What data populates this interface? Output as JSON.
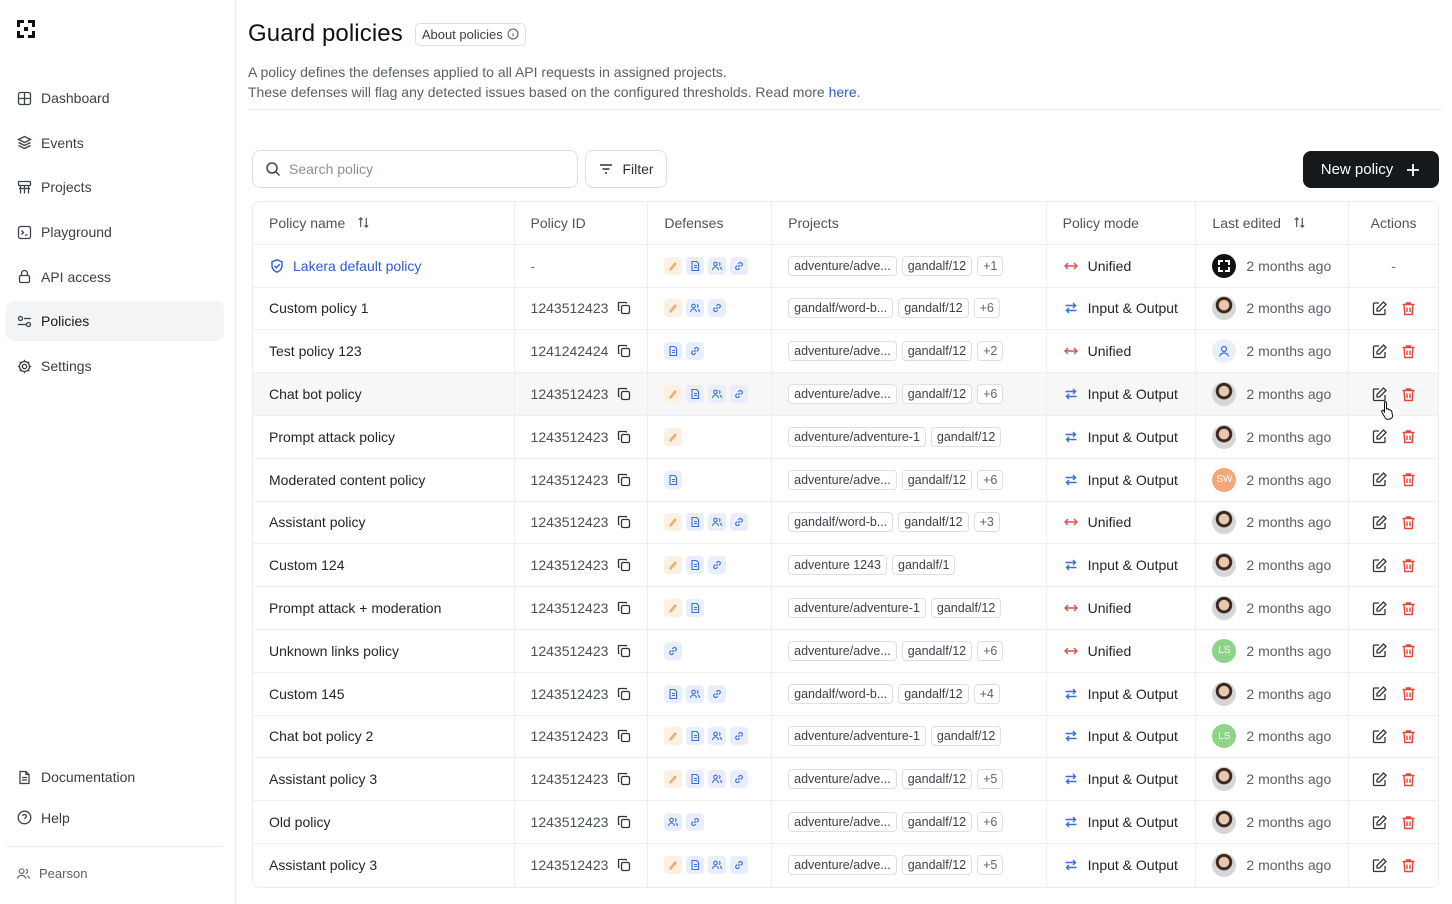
{
  "sidebar": {
    "logo": "lakera-logo",
    "items": [
      {
        "label": "Dashboard",
        "icon": "grid-icon"
      },
      {
        "label": "Events",
        "icon": "layers-icon"
      },
      {
        "label": "Projects",
        "icon": "sitemap-icon"
      },
      {
        "label": "Playground",
        "icon": "terminal-icon"
      },
      {
        "label": "API access",
        "icon": "lock-icon"
      },
      {
        "label": "Policies",
        "icon": "sliders-icon",
        "active": true
      },
      {
        "label": "Settings",
        "icon": "gear-icon"
      }
    ],
    "bottom_items": [
      {
        "label": "Documentation",
        "icon": "document-icon"
      },
      {
        "label": "Help",
        "icon": "help-icon"
      }
    ],
    "user": "Pearson"
  },
  "header": {
    "title": "Guard policies",
    "about_label": "About policies",
    "description_line1": "A policy defines the defenses applied to all API requests in assigned projects.",
    "description_line2": "These defenses will flag any detected issues based on the configured thresholds. Read more ",
    "description_link": "here",
    "description_end": "."
  },
  "toolbar": {
    "search_placeholder": "Search policy",
    "filter_label": "Filter",
    "new_policy_label": "New policy"
  },
  "table": {
    "columns": [
      "Policy name",
      "Policy ID",
      "Defenses",
      "Projects",
      "Policy mode",
      "Last edited",
      "Actions"
    ],
    "rows": [
      {
        "name": "Lakera default policy",
        "id": "-",
        "defenses": [
          "prompt",
          "content",
          "pii",
          "link"
        ],
        "projects": [
          "adventure/adve...",
          "gandalf/12"
        ],
        "more": "+1",
        "mode": "Unified",
        "avatar": "lakera",
        "edited": "2 months ago",
        "default": true
      },
      {
        "name": "Custom policy 1",
        "id": "1243512423",
        "defenses": [
          "prompt",
          "pii",
          "link"
        ],
        "projects": [
          "gandalf/word-b...",
          "gandalf/12"
        ],
        "more": "+6",
        "mode": "Input & Output",
        "avatar": "photo",
        "edited": "2 months ago"
      },
      {
        "name": "Test policy 123",
        "id": "1241242424",
        "defenses": [
          "content",
          "link"
        ],
        "projects": [
          "adventure/adve...",
          "gandalf/12"
        ],
        "more": "+2",
        "mode": "Unified",
        "avatar": "user",
        "edited": "2 months ago"
      },
      {
        "name": "Chat bot policy",
        "id": "1243512423",
        "defenses": [
          "prompt",
          "content",
          "pii",
          "link"
        ],
        "projects": [
          "adventure/adve...",
          "gandalf/12"
        ],
        "more": "+6",
        "mode": "Input & Output",
        "avatar": "photo",
        "edited": "2 months ago",
        "hover": true
      },
      {
        "name": "Prompt attack policy",
        "id": "1243512423",
        "defenses": [
          "prompt"
        ],
        "projects": [
          "adventure/adventure-1",
          "gandalf/12"
        ],
        "more": "",
        "mode": "Input & Output",
        "avatar": "photo",
        "edited": "2 months ago"
      },
      {
        "name": "Moderated content policy",
        "id": "1243512423",
        "defenses": [
          "content"
        ],
        "projects": [
          "adventure/adve...",
          "gandalf/12"
        ],
        "more": "+6",
        "mode": "Input & Output",
        "avatar": "SW",
        "edited": "2 months ago"
      },
      {
        "name": "Assistant policy",
        "id": "1243512423",
        "defenses": [
          "prompt",
          "content",
          "pii",
          "link"
        ],
        "projects": [
          "gandalf/word-b...",
          "gandalf/12"
        ],
        "more": "+3",
        "mode": "Unified",
        "avatar": "photo",
        "edited": "2 months ago"
      },
      {
        "name": "Custom 124",
        "id": "1243512423",
        "defenses": [
          "prompt",
          "content",
          "link"
        ],
        "projects": [
          "adventure 1243",
          "gandalf/1"
        ],
        "more": "",
        "mode": "Input & Output",
        "avatar": "photo",
        "edited": "2 months ago"
      },
      {
        "name": "Prompt attack + moderation",
        "id": "1243512423",
        "defenses": [
          "prompt",
          "content"
        ],
        "projects": [
          "adventure/adventure-1",
          "gandalf/12"
        ],
        "more": "",
        "mode": "Unified",
        "avatar": "photo",
        "edited": "2 months ago"
      },
      {
        "name": "Unknown links policy",
        "id": "1243512423",
        "defenses": [
          "link"
        ],
        "projects": [
          "adventure/adve...",
          "gandalf/12"
        ],
        "more": "+6",
        "mode": "Unified",
        "avatar": "LS",
        "edited": "2 months ago"
      },
      {
        "name": "Custom 145",
        "id": "1243512423",
        "defenses": [
          "content",
          "pii",
          "link"
        ],
        "projects": [
          "gandalf/word-b...",
          "gandalf/12"
        ],
        "more": "+4",
        "mode": "Input & Output",
        "avatar": "photo",
        "edited": "2 months ago"
      },
      {
        "name": "Chat bot policy 2",
        "id": "1243512423",
        "defenses": [
          "prompt",
          "content",
          "pii",
          "link"
        ],
        "projects": [
          "adventure/adventure-1",
          "gandalf/12"
        ],
        "more": "",
        "mode": "Input & Output",
        "avatar": "LS",
        "edited": "2 months ago"
      },
      {
        "name": "Assistant policy 3",
        "id": "1243512423",
        "defenses": [
          "prompt",
          "content",
          "pii",
          "link"
        ],
        "projects": [
          "adventure/adve...",
          "gandalf/12"
        ],
        "more": "+5",
        "mode": "Input & Output",
        "avatar": "photo",
        "edited": "2 months ago"
      },
      {
        "name": "Old policy",
        "id": "1243512423",
        "defenses": [
          "pii",
          "link"
        ],
        "projects": [
          "adventure/adve...",
          "gandalf/12"
        ],
        "more": "+6",
        "mode": "Input & Output",
        "avatar": "photo",
        "edited": "2 months ago"
      },
      {
        "name": "Assistant policy 3",
        "id": "1243512423",
        "defenses": [
          "prompt",
          "content",
          "pii",
          "link"
        ],
        "projects": [
          "adventure/adve...",
          "gandalf/12"
        ],
        "more": "+5",
        "mode": "Input & Output",
        "avatar": "photo",
        "edited": "2 months ago"
      }
    ]
  },
  "colors": {
    "accent": "#2f5bd3",
    "delete": "#e0483a",
    "unified": "#d9534f",
    "io": "#3a6fd8",
    "primary_button": "#16191c"
  }
}
